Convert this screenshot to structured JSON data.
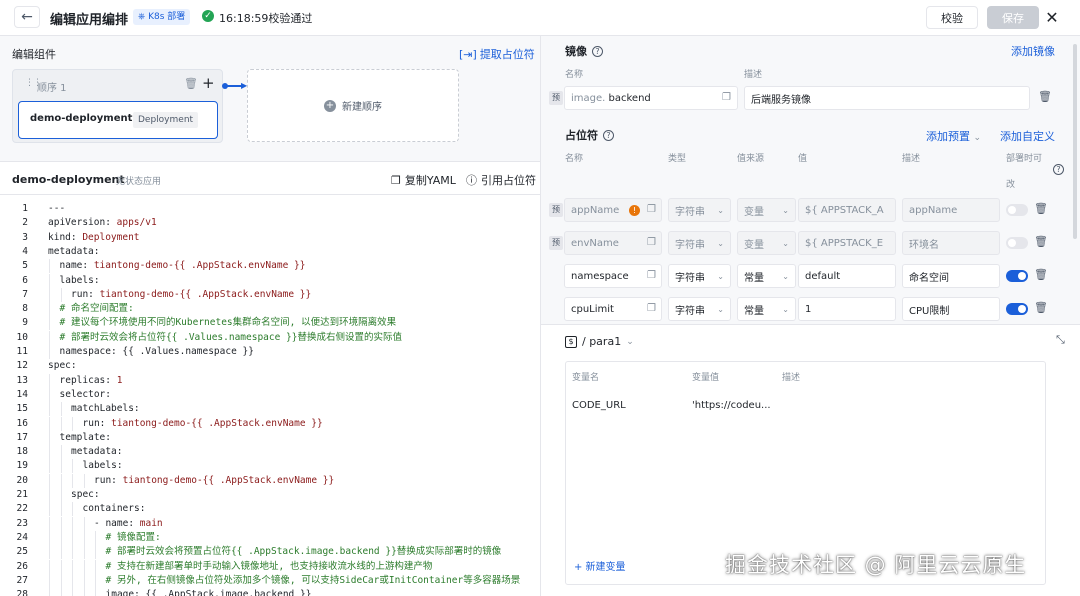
{
  "header": {
    "back_icon": "arrow-left",
    "title": "编辑应用编排",
    "badge": "K8s 部署",
    "status": "16:18:59校验通过",
    "verify_label": "校验",
    "save_label": "保存"
  },
  "left": {
    "components_title": "编辑组件",
    "extract_label": "提取占位符",
    "stage_label": "顺序 1",
    "deployment_name": "demo-deployment",
    "deployment_tag": "Deployment",
    "new_stage_label": "新建顺序",
    "yaml_name": "demo-deployment",
    "yaml_type": "无状态应用",
    "copy_yaml_label": "复制YAML",
    "ref_placeholder_label": "引用占位符"
  },
  "code_lines": [
    {
      "n": "1",
      "i": 0,
      "t": [
        [
          "plain",
          "---"
        ]
      ]
    },
    {
      "n": "2",
      "i": 0,
      "t": [
        [
          "k",
          "apiVersion: "
        ],
        [
          "v",
          "apps/v1"
        ]
      ]
    },
    {
      "n": "3",
      "i": 0,
      "t": [
        [
          "k",
          "kind: "
        ],
        [
          "v",
          "Deployment"
        ]
      ]
    },
    {
      "n": "4",
      "i": 0,
      "t": [
        [
          "k",
          "metadata:"
        ]
      ]
    },
    {
      "n": "5",
      "i": 1,
      "t": [
        [
          "k",
          "name: "
        ],
        [
          "v",
          "tiantong-demo-{{ .AppStack.envName }}"
        ]
      ]
    },
    {
      "n": "6",
      "i": 1,
      "t": [
        [
          "k",
          "labels:"
        ]
      ]
    },
    {
      "n": "7",
      "i": 2,
      "t": [
        [
          "k",
          "run: "
        ],
        [
          "v",
          "tiantong-demo-{{ .AppStack.envName }}"
        ]
      ]
    },
    {
      "n": "8",
      "i": 1,
      "t": [
        [
          "cm",
          "# 命名空间配置:"
        ]
      ]
    },
    {
      "n": "9",
      "i": 1,
      "t": [
        [
          "cm",
          "# 建议每个环境使用不同的Kubernetes集群命名空间, 以便达到环境隔离效果"
        ]
      ]
    },
    {
      "n": "10",
      "i": 1,
      "t": [
        [
          "cm",
          "# 部署时云效会将占位符{{ .Values.namespace }}替换成右侧设置的实际值"
        ]
      ]
    },
    {
      "n": "11",
      "i": 1,
      "t": [
        [
          "k",
          "namespace: "
        ],
        [
          "plain",
          "{{ .Values.namespace }}"
        ]
      ]
    },
    {
      "n": "12",
      "i": 0,
      "t": [
        [
          "k",
          "spec:"
        ]
      ]
    },
    {
      "n": "13",
      "i": 1,
      "t": [
        [
          "k",
          "replicas: "
        ],
        [
          "v",
          "1"
        ]
      ]
    },
    {
      "n": "14",
      "i": 1,
      "t": [
        [
          "k",
          "selector:"
        ]
      ]
    },
    {
      "n": "15",
      "i": 2,
      "t": [
        [
          "k",
          "matchLabels:"
        ]
      ]
    },
    {
      "n": "16",
      "i": 3,
      "t": [
        [
          "k",
          "run: "
        ],
        [
          "v",
          "tiantong-demo-{{ .AppStack.envName }}"
        ]
      ]
    },
    {
      "n": "17",
      "i": 1,
      "t": [
        [
          "k",
          "template:"
        ]
      ]
    },
    {
      "n": "18",
      "i": 2,
      "t": [
        [
          "k",
          "metadata:"
        ]
      ]
    },
    {
      "n": "19",
      "i": 3,
      "t": [
        [
          "k",
          "labels:"
        ]
      ]
    },
    {
      "n": "20",
      "i": 4,
      "t": [
        [
          "k",
          "run: "
        ],
        [
          "v",
          "tiantong-demo-{{ .AppStack.envName }}"
        ]
      ]
    },
    {
      "n": "21",
      "i": 2,
      "t": [
        [
          "k",
          "spec:"
        ]
      ]
    },
    {
      "n": "22",
      "i": 3,
      "t": [
        [
          "k",
          "containers:"
        ]
      ]
    },
    {
      "n": "23",
      "i": 4,
      "t": [
        [
          "k",
          "- name: "
        ],
        [
          "v",
          "main"
        ]
      ]
    },
    {
      "n": "24",
      "i": 5,
      "t": [
        [
          "cm",
          "# 镜像配置:"
        ]
      ]
    },
    {
      "n": "25",
      "i": 5,
      "t": [
        [
          "cm",
          "# 部署时云效会将预置占位符{{ .AppStack.image.backend }}替换成实际部署时的镜像"
        ]
      ]
    },
    {
      "n": "26",
      "i": 5,
      "t": [
        [
          "cm",
          "# 支持在新建部署单时手动输入镜像地址, 也支持接收流水线的上游构建产物"
        ]
      ]
    },
    {
      "n": "27",
      "i": 5,
      "t": [
        [
          "cm",
          "# 另外, 在右侧镜像占位符处添加多个镜像, 可以支持SideCar或InitContainer等多容器场景"
        ]
      ]
    },
    {
      "n": "28",
      "i": 5,
      "t": [
        [
          "k",
          "image: "
        ],
        [
          "plain",
          "{{ .AppStack.image.backend }}"
        ]
      ]
    }
  ],
  "right": {
    "image_section": {
      "title": "镜像",
      "add_label": "添加镜像",
      "col_name": "名称",
      "col_desc": "描述",
      "row": {
        "prefix": "预",
        "name_placeholder": "image.",
        "name_value": "backend",
        "desc": "后端服务镜像"
      }
    },
    "placeholder_section": {
      "title": "占位符",
      "add_preset": "添加预置",
      "add_custom": "添加自定义",
      "cols": {
        "name": "名称",
        "type": "类型",
        "source": "值来源",
        "value": "值",
        "desc": "描述",
        "runtime1": "部署时可",
        "runtime2": "改"
      },
      "rows": [
        {
          "prefix": "预",
          "name": "appName",
          "type": "字符串",
          "source": "变量",
          "value": "${ APPSTACK_A",
          "desc": "appName",
          "disabled": true,
          "toggle": false,
          "warn": "!"
        },
        {
          "prefix": "预",
          "name": "envName",
          "type": "字符串",
          "source": "变量",
          "value": "${ APPSTACK_E",
          "desc": "环境名",
          "disabled": true,
          "toggle": false
        },
        {
          "prefix": "",
          "name": "namespace",
          "type": "字符串",
          "source": "常量",
          "value": "default",
          "desc": "命名空间",
          "disabled": false,
          "toggle": true
        },
        {
          "prefix": "",
          "name": "cpuLimit",
          "type": "字符串",
          "source": "常量",
          "value": "1",
          "desc": "CPU限制",
          "disabled": false,
          "toggle": true
        }
      ]
    },
    "para": {
      "icon": "$",
      "path": "/ para1",
      "cols": {
        "name": "变量名",
        "value": "变量值",
        "desc": "描述"
      },
      "rows": [
        {
          "name": "CODE_URL",
          "value": "'https://codeu..."
        }
      ],
      "new_var": "+ 新建变量"
    }
  },
  "watermark": "掘金技术社区 @ 阿里云云原生"
}
